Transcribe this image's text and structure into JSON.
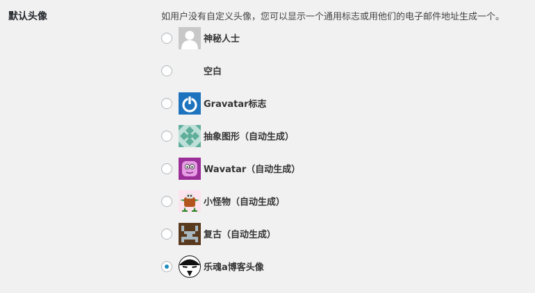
{
  "section": {
    "label": "默认头像",
    "description": "如用户没有自定义头像，您可以显示一个通用标志或用他们的电子邮件地址生成一个。"
  },
  "options": [
    {
      "label": "神秘人士",
      "icon": "mystery-person-icon",
      "checked": false
    },
    {
      "label": "空白",
      "icon": "blank-icon",
      "checked": false
    },
    {
      "label": "Gravatar标志",
      "icon": "gravatar-logo-icon",
      "checked": false
    },
    {
      "label": "抽象图形（自动生成）",
      "icon": "identicon-icon",
      "checked": false
    },
    {
      "label": "Wavatar（自动生成）",
      "icon": "wavatar-icon",
      "checked": false
    },
    {
      "label": "小怪物（自动生成）",
      "icon": "monsterid-icon",
      "checked": false
    },
    {
      "label": "复古（自动生成）",
      "icon": "retro-icon",
      "checked": false
    },
    {
      "label": "乐魂a博客头像",
      "icon": "custom-blog-avatar-icon",
      "checked": true
    }
  ],
  "colors": {
    "background": "#f1f1f1",
    "radio_checked": "#1e8cbe",
    "gravatar_blue": "#1e73be"
  }
}
